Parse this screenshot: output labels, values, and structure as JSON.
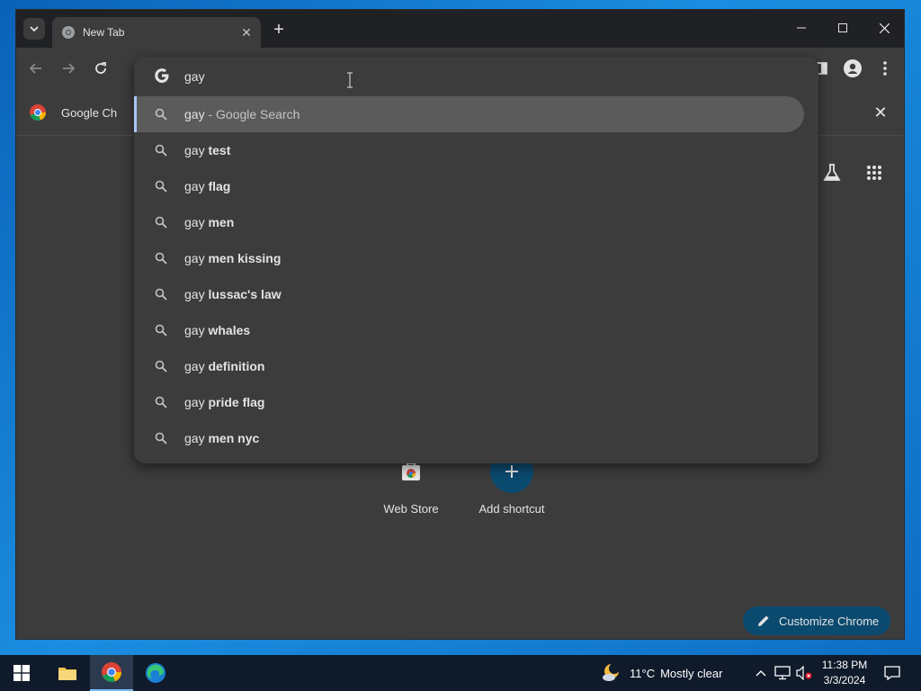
{
  "browser": {
    "tab": {
      "title": "New Tab"
    },
    "bookmark": {
      "label": "Google Ch"
    },
    "omnibox": {
      "query": "gay",
      "suggestions": [
        {
          "prefix": "gay",
          "suffix": "",
          "extra": "- Google Search"
        },
        {
          "prefix": "gay",
          "suffix": "test",
          "extra": ""
        },
        {
          "prefix": "gay",
          "suffix": "flag",
          "extra": ""
        },
        {
          "prefix": "gay",
          "suffix": "men",
          "extra": ""
        },
        {
          "prefix": "gay",
          "suffix": "men kissing",
          "extra": ""
        },
        {
          "prefix": "gay",
          "suffix": "lussac's law",
          "extra": ""
        },
        {
          "prefix": "gay",
          "suffix": "whales",
          "extra": ""
        },
        {
          "prefix": "gay",
          "suffix": "definition",
          "extra": ""
        },
        {
          "prefix": "gay",
          "suffix": "pride flag",
          "extra": ""
        },
        {
          "prefix": "gay",
          "suffix": "men nyc",
          "extra": ""
        }
      ]
    },
    "ntp": {
      "shortcuts": [
        {
          "label": "Web Store"
        },
        {
          "label": "Add shortcut"
        }
      ],
      "customize_label": "Customize Chrome"
    }
  },
  "taskbar": {
    "weather": {
      "temp": "11°C",
      "condition": "Mostly clear"
    },
    "clock": {
      "time": "11:38 PM",
      "date": "3/3/2024"
    }
  },
  "colors": {
    "accent": "#a8c7fa",
    "customize_bg": "#0b4a6f",
    "add_shortcut_bg": "#0b4a6f"
  }
}
